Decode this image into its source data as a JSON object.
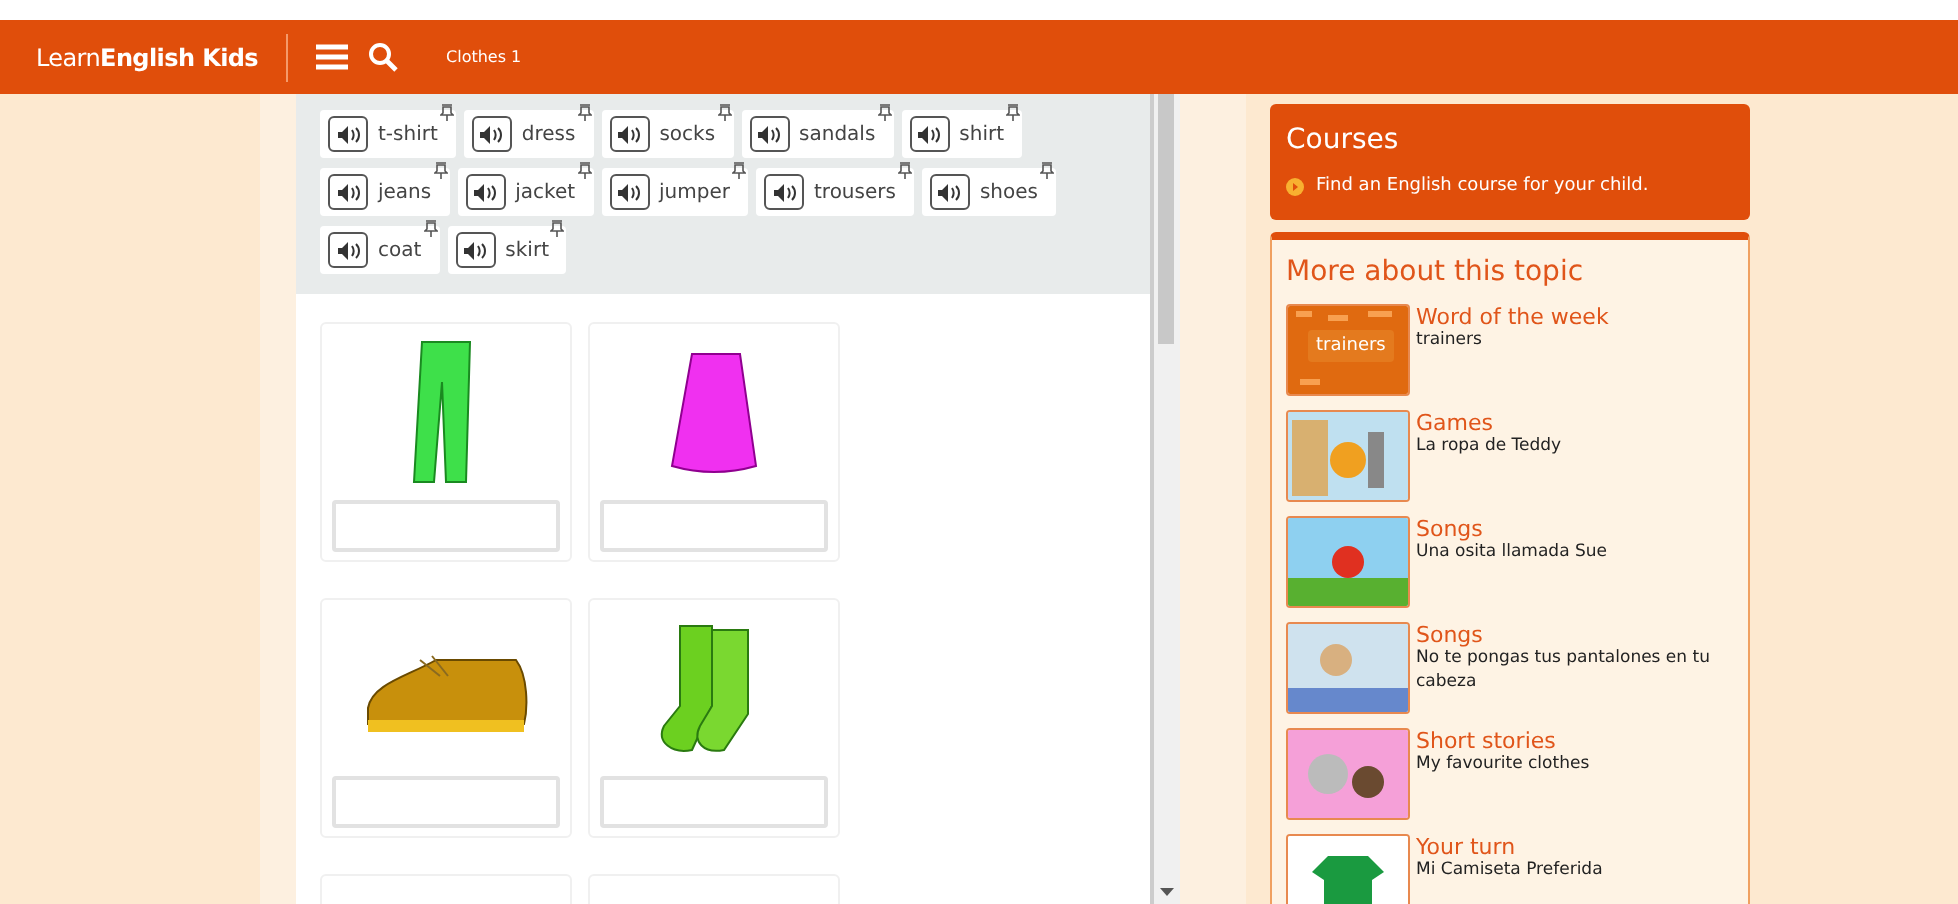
{
  "header": {
    "brand_light": "Learn",
    "brand_bold": "English Kids",
    "page_title": "Clothes 1"
  },
  "word_bank": [
    {
      "word": "t-shirt"
    },
    {
      "word": "dress"
    },
    {
      "word": "socks"
    },
    {
      "word": "sandals"
    },
    {
      "word": "shirt"
    },
    {
      "word": "jeans"
    },
    {
      "word": "jacket"
    },
    {
      "word": "jumper"
    },
    {
      "word": "trousers"
    },
    {
      "word": "shoes"
    },
    {
      "word": "coat"
    },
    {
      "word": "skirt"
    }
  ],
  "cards": [
    {
      "kind": "trousers"
    },
    {
      "kind": "skirt"
    },
    {
      "kind": "shoe"
    },
    {
      "kind": "socks"
    },
    {
      "kind": "blank"
    },
    {
      "kind": "blank"
    }
  ],
  "courses": {
    "title": "Courses",
    "link": "Find an English course for your child."
  },
  "more": {
    "title": "More about this topic",
    "items": [
      {
        "category": "Word of the week",
        "subtitle": "trainers",
        "thumb_label": "trainers",
        "kind": "orange"
      },
      {
        "category": "Games",
        "subtitle": "La ropa de Teddy",
        "kind": "play"
      },
      {
        "category": "Songs",
        "subtitle": "Una osita llamada Sue",
        "kind": "outdoor"
      },
      {
        "category": "Songs",
        "subtitle": "No te pongas tus pantalones en tu cabeza",
        "kind": "room"
      },
      {
        "category": "Short stories",
        "subtitle": "My favourite clothes",
        "kind": "pink"
      },
      {
        "category": "Your turn",
        "subtitle": "Mi Camiseta Preferida",
        "kind": "shirt"
      }
    ]
  }
}
